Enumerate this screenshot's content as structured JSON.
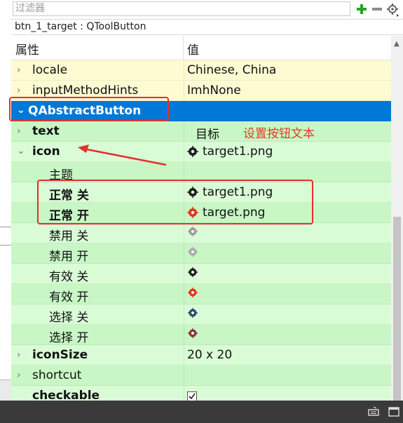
{
  "filter": {
    "placeholder": "过滤器"
  },
  "toolbar": {
    "add_icon": "plus-icon",
    "remove_icon": "minus-icon",
    "config_icon": "settings-icon"
  },
  "object_line": "btn_1_target : QToolButton",
  "headers": {
    "property": "属性",
    "value": "值"
  },
  "rows": [
    {
      "name": "locale",
      "value": "Chinese, China"
    },
    {
      "name": "inputMethodHints",
      "value": "ImhNone"
    },
    {
      "name": "QAbstractButton",
      "value": ""
    },
    {
      "name": "text",
      "value": "目标"
    },
    {
      "name": "icon",
      "value": "target1.png"
    },
    {
      "name": "主题",
      "value": ""
    },
    {
      "name": "正常 关",
      "value": "target1.png"
    },
    {
      "name": "正常 开",
      "value": "target.png"
    },
    {
      "name": "禁用 关",
      "value": ""
    },
    {
      "name": "禁用 开",
      "value": ""
    },
    {
      "name": "有效 关",
      "value": ""
    },
    {
      "name": "有效 开",
      "value": ""
    },
    {
      "name": "选择 关",
      "value": ""
    },
    {
      "name": "选择 开",
      "value": ""
    },
    {
      "name": "iconSize",
      "value": "20 x 20"
    },
    {
      "name": "shortcut",
      "value": ""
    },
    {
      "name": "checkable",
      "value": ""
    }
  ],
  "annotation": "设置按钮文本",
  "colors": {
    "selected": "#0078d7",
    "yellow_row": "#fefad2",
    "green_row": "#c8f7c5",
    "annotation": "#e23a28"
  }
}
